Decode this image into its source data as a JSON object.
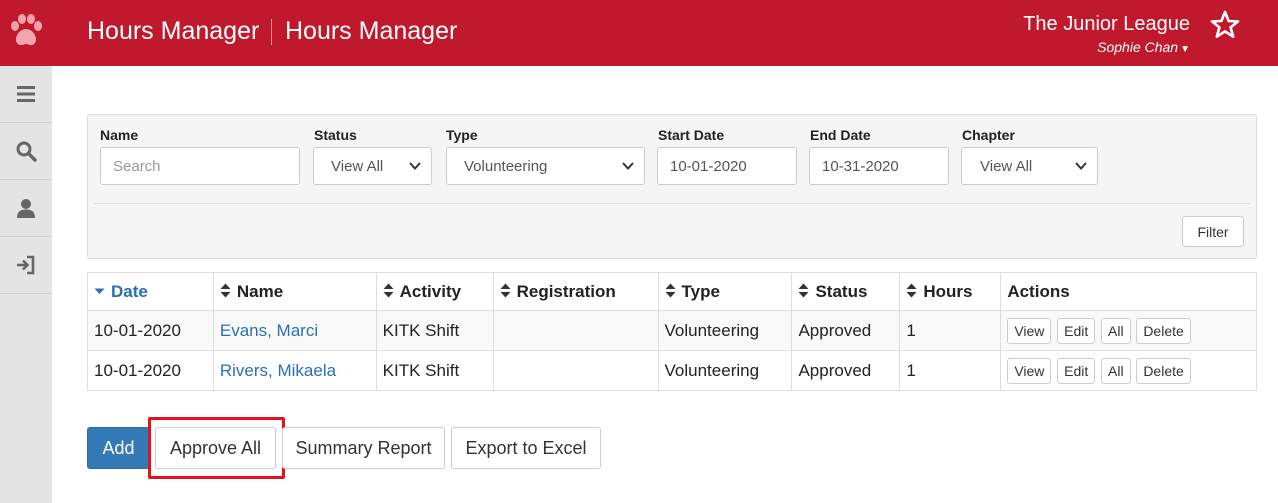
{
  "header": {
    "app_title": "Hours Manager",
    "page_title": "Hours Manager",
    "org_name": "The Junior League",
    "user_name": "Sophie Chan",
    "brand_color": "#c0192d"
  },
  "sidebar": {
    "items": [
      {
        "icon": "menu-icon"
      },
      {
        "icon": "search-icon"
      },
      {
        "icon": "user-icon"
      },
      {
        "icon": "sign-in-icon"
      }
    ]
  },
  "filters": {
    "name_label": "Name",
    "name_placeholder": "Search",
    "status_label": "Status",
    "status_value": "View All",
    "type_label": "Type",
    "type_value": "Volunteering",
    "start_label": "Start Date",
    "start_value": "10-01-2020",
    "end_label": "End Date",
    "end_value": "10-31-2020",
    "chapter_label": "Chapter",
    "chapter_value": "View All",
    "filter_button": "Filter"
  },
  "table": {
    "headers": [
      "Date",
      "Name",
      "Activity",
      "Registration",
      "Type",
      "Status",
      "Hours",
      "Actions"
    ],
    "rows": [
      {
        "date": "10-01-2020",
        "name": "Evans, Marci",
        "activity": "KITK Shift",
        "registration": "",
        "type": "Volunteering",
        "status": "Approved",
        "hours": "1"
      },
      {
        "date": "10-01-2020",
        "name": "Rivers, Mikaela",
        "activity": "KITK Shift",
        "registration": "",
        "type": "Volunteering",
        "status": "Approved",
        "hours": "1"
      }
    ],
    "actions": {
      "view": "View",
      "edit": "Edit",
      "all": "All",
      "delete": "Delete"
    }
  },
  "buttons": {
    "add": "Add",
    "approve_all": "Approve All",
    "summary_report": "Summary Report",
    "export_excel": "Export to Excel"
  }
}
